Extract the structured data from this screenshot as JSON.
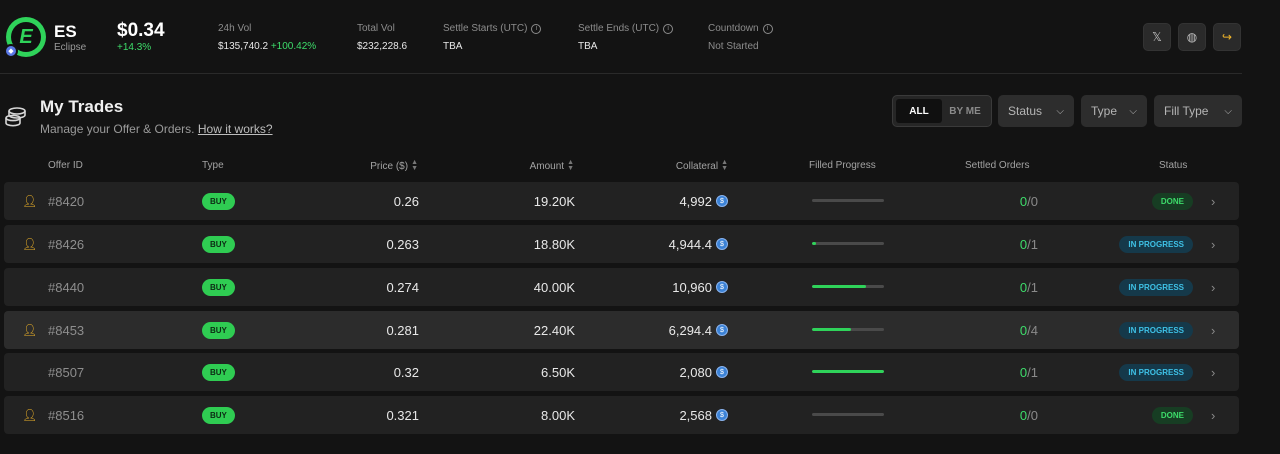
{
  "token": {
    "symbol": "ES",
    "name": "Eclipse",
    "logo_letter": "E",
    "price": "$0.34",
    "price_change": "+14.3%"
  },
  "stats": {
    "vol_24h": {
      "label": "24h Vol",
      "value": "$135,740.2",
      "change": "+100.42%"
    },
    "total_vol": {
      "label": "Total Vol",
      "value": "$232,228.6"
    },
    "settle_starts": {
      "label": "Settle Starts (UTC)",
      "value": "TBA"
    },
    "settle_ends": {
      "label": "Settle Ends (UTC)",
      "value": "TBA"
    },
    "countdown": {
      "label": "Countdown",
      "value": "Not Started"
    }
  },
  "header_actions": [
    {
      "icon": "x-icon",
      "glyph": "𝕏"
    },
    {
      "icon": "globe-icon",
      "glyph": "◍"
    },
    {
      "icon": "share-icon",
      "glyph": "↪"
    }
  ],
  "section": {
    "title": "My Trades",
    "subtitle": "Manage your Offer & Orders.",
    "link": "How it works?"
  },
  "filters": {
    "segment": [
      "ALL",
      "BY ME"
    ],
    "status": "Status",
    "type": "Type",
    "fill_type": "Fill Type"
  },
  "columns": {
    "offer_id": "Offer ID",
    "type": "Type",
    "price": "Price ($)",
    "amount": "Amount",
    "collateral": "Collateral",
    "filled": "Filled Progress",
    "settled": "Settled Orders",
    "status": "Status"
  },
  "rows": [
    {
      "id": "#8420",
      "mine": true,
      "type": "BUY",
      "price": "0.26",
      "amount": "19.20K",
      "collateral": "4,992",
      "fill": 0,
      "settled_done": "0",
      "settled_total": "/0",
      "status": "DONE",
      "status_kind": "done",
      "highlight": false
    },
    {
      "id": "#8426",
      "mine": true,
      "type": "BUY",
      "price": "0.263",
      "amount": "18.80K",
      "collateral": "4,944.4",
      "fill": 5,
      "settled_done": "0",
      "settled_total": "/1",
      "status": "IN PROGRESS",
      "status_kind": "prog",
      "highlight": false
    },
    {
      "id": "#8440",
      "mine": false,
      "type": "BUY",
      "price": "0.274",
      "amount": "40.00K",
      "collateral": "10,960",
      "fill": 75,
      "settled_done": "0",
      "settled_total": "/1",
      "status": "IN PROGRESS",
      "status_kind": "prog",
      "highlight": false
    },
    {
      "id": "#8453",
      "mine": true,
      "type": "BUY",
      "price": "0.281",
      "amount": "22.40K",
      "collateral": "6,294.4",
      "fill": 54,
      "settled_done": "0",
      "settled_total": "/4",
      "status": "IN PROGRESS",
      "status_kind": "prog",
      "highlight": true
    },
    {
      "id": "#8507",
      "mine": false,
      "type": "BUY",
      "price": "0.32",
      "amount": "6.50K",
      "collateral": "2,080",
      "fill": 100,
      "settled_done": "0",
      "settled_total": "/1",
      "status": "IN PROGRESS",
      "status_kind": "prog",
      "highlight": false
    },
    {
      "id": "#8516",
      "mine": true,
      "type": "BUY",
      "price": "0.321",
      "amount": "8.00K",
      "collateral": "2,568",
      "fill": 0,
      "settled_done": "0",
      "settled_total": "/0",
      "status": "DONE",
      "status_kind": "done",
      "highlight": false
    }
  ]
}
